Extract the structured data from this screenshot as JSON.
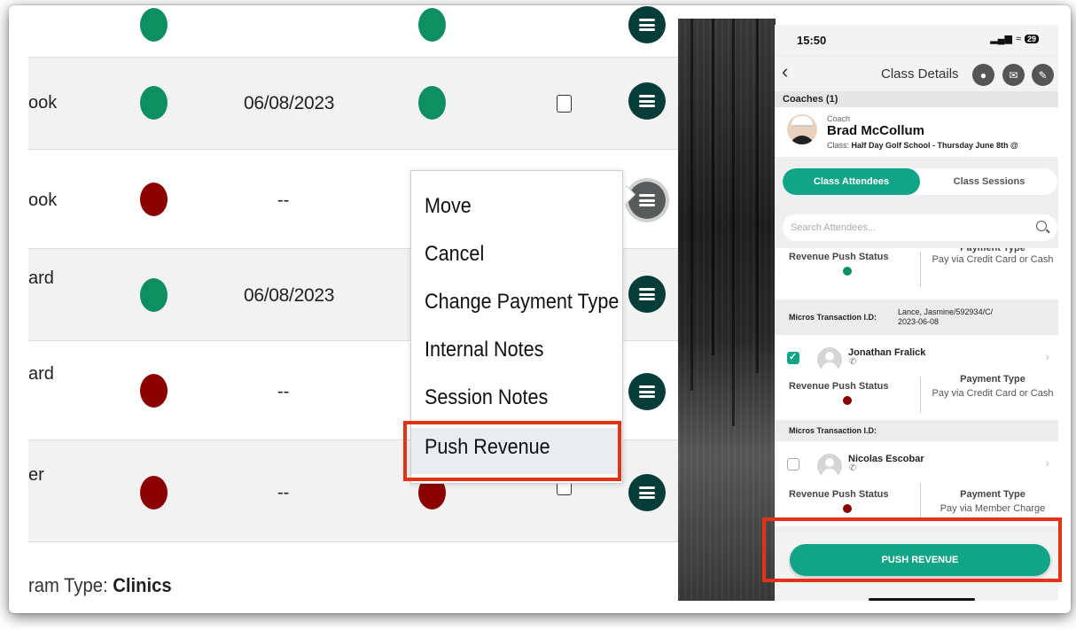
{
  "left_table": {
    "rows": [
      {
        "name": "ook",
        "date": "06/08/2023"
      },
      {
        "name": "ook",
        "date": "--"
      },
      {
        "name": "ard",
        "date": "06/08/2023"
      },
      {
        "name": "ard",
        "date": "--"
      },
      {
        "name": "er",
        "date": "--"
      }
    ],
    "footer_label": "ram Type: ",
    "footer_value": "Clinics"
  },
  "context_menu": {
    "items": [
      "Move",
      "Cancel",
      "Change Payment Type",
      "Internal Notes",
      "Session Notes",
      "Push Revenue"
    ]
  },
  "phone": {
    "time": "15:50",
    "battery": "29",
    "title": "Class Details",
    "coaches_header": "Coaches (1)",
    "coach_role": "Coach",
    "coach_name": "Brad McCollum",
    "coach_class_label": "Class:",
    "coach_class_value": "Half Day Golf School - Thursday June 8th @",
    "tab_attendees": "Class Attendees",
    "tab_sessions": "Class Sessions",
    "search_placeholder": "Search Attendees...",
    "partial_payment_type": "Payment Type",
    "rps_label": "Revenue Push Status",
    "pt_label": "Payment Type",
    "entry0_payment": "Pay via Credit Card or Cash",
    "micros_label": "Micros Transaction I.D:",
    "entry0_micros_value_1": "Lance, Jasmine/592934/C/",
    "entry0_micros_value_2": "2023-06-08",
    "attendee1_name": "Jonathan Fralick",
    "attendee1_payment": "Pay via Credit Card or Cash",
    "attendee2_name": "Nicolas Escobar",
    "attendee2_payment": "Pay via Member Charge",
    "push_button": "PUSH REVENUE"
  },
  "colors": {
    "green_status": "#0d8f62",
    "red_status": "#8b0000",
    "menu_button": "#063d38",
    "accent": "#11a487",
    "highlight_box": "#e23218"
  },
  "icons": {
    "row_menu": "hamburger-icon",
    "nav": [
      "back-chevron-icon",
      "palette-icon",
      "mail-icon",
      "edit-icon"
    ],
    "search": "search-icon"
  }
}
